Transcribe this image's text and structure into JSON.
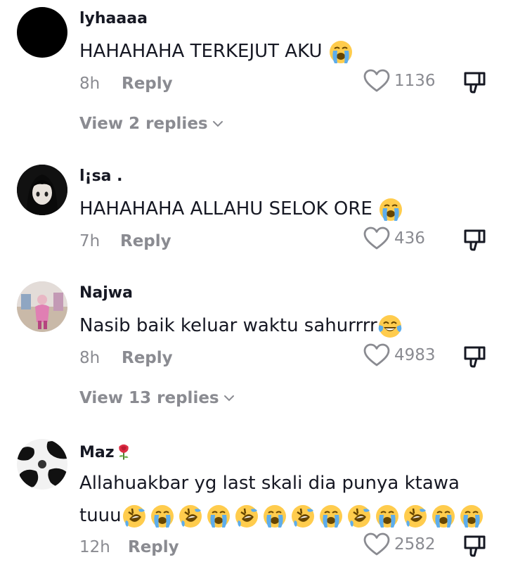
{
  "comments": [
    {
      "username": "lyhaaaa",
      "text": "HAHAHAHA TERKEJUT AKU",
      "emojis": [
        "crying-face"
      ],
      "time": "8h",
      "reply_label": "Reply",
      "likes": "1136",
      "view_replies": "View 2 replies",
      "avatar": "black-circle"
    },
    {
      "username": "l¡sa .",
      "text": "HAHAHAHA ALLAHU SELOK ORE",
      "emojis": [
        "crying-face"
      ],
      "time": "7h",
      "reply_label": "Reply",
      "likes": "436",
      "avatar": "dark-anime-girl"
    },
    {
      "username": "Najwa",
      "text": "Nasib baik keluar waktu sahurrrr",
      "emojis": [
        "tears-of-joy"
      ],
      "time": "8h",
      "reply_label": "Reply",
      "likes": "4983",
      "view_replies": "View 13 replies",
      "avatar": "pink-figure-photo"
    },
    {
      "username": "Maz",
      "username_emoji": "rose",
      "text_line1": "Allahuakbar yg last skali dia punya ktawa",
      "text_line2": "tuuu",
      "emojis_line2": [
        "rolling-on-floor-laughing",
        "crying-face",
        "rolling-on-floor-laughing",
        "crying-face",
        "rolling-on-floor-laughing",
        "crying-face",
        "rolling-on-floor-laughing",
        "crying-face",
        "rolling-on-floor-laughing",
        "crying-face",
        "rolling-on-floor-laughing",
        "crying-face",
        "crying-face"
      ],
      "time": "12h",
      "reply_label": "Reply",
      "likes": "2582",
      "avatar": "bw-pattern"
    }
  ],
  "colors": {
    "text": "#161823",
    "muted": "#8a8b91"
  }
}
